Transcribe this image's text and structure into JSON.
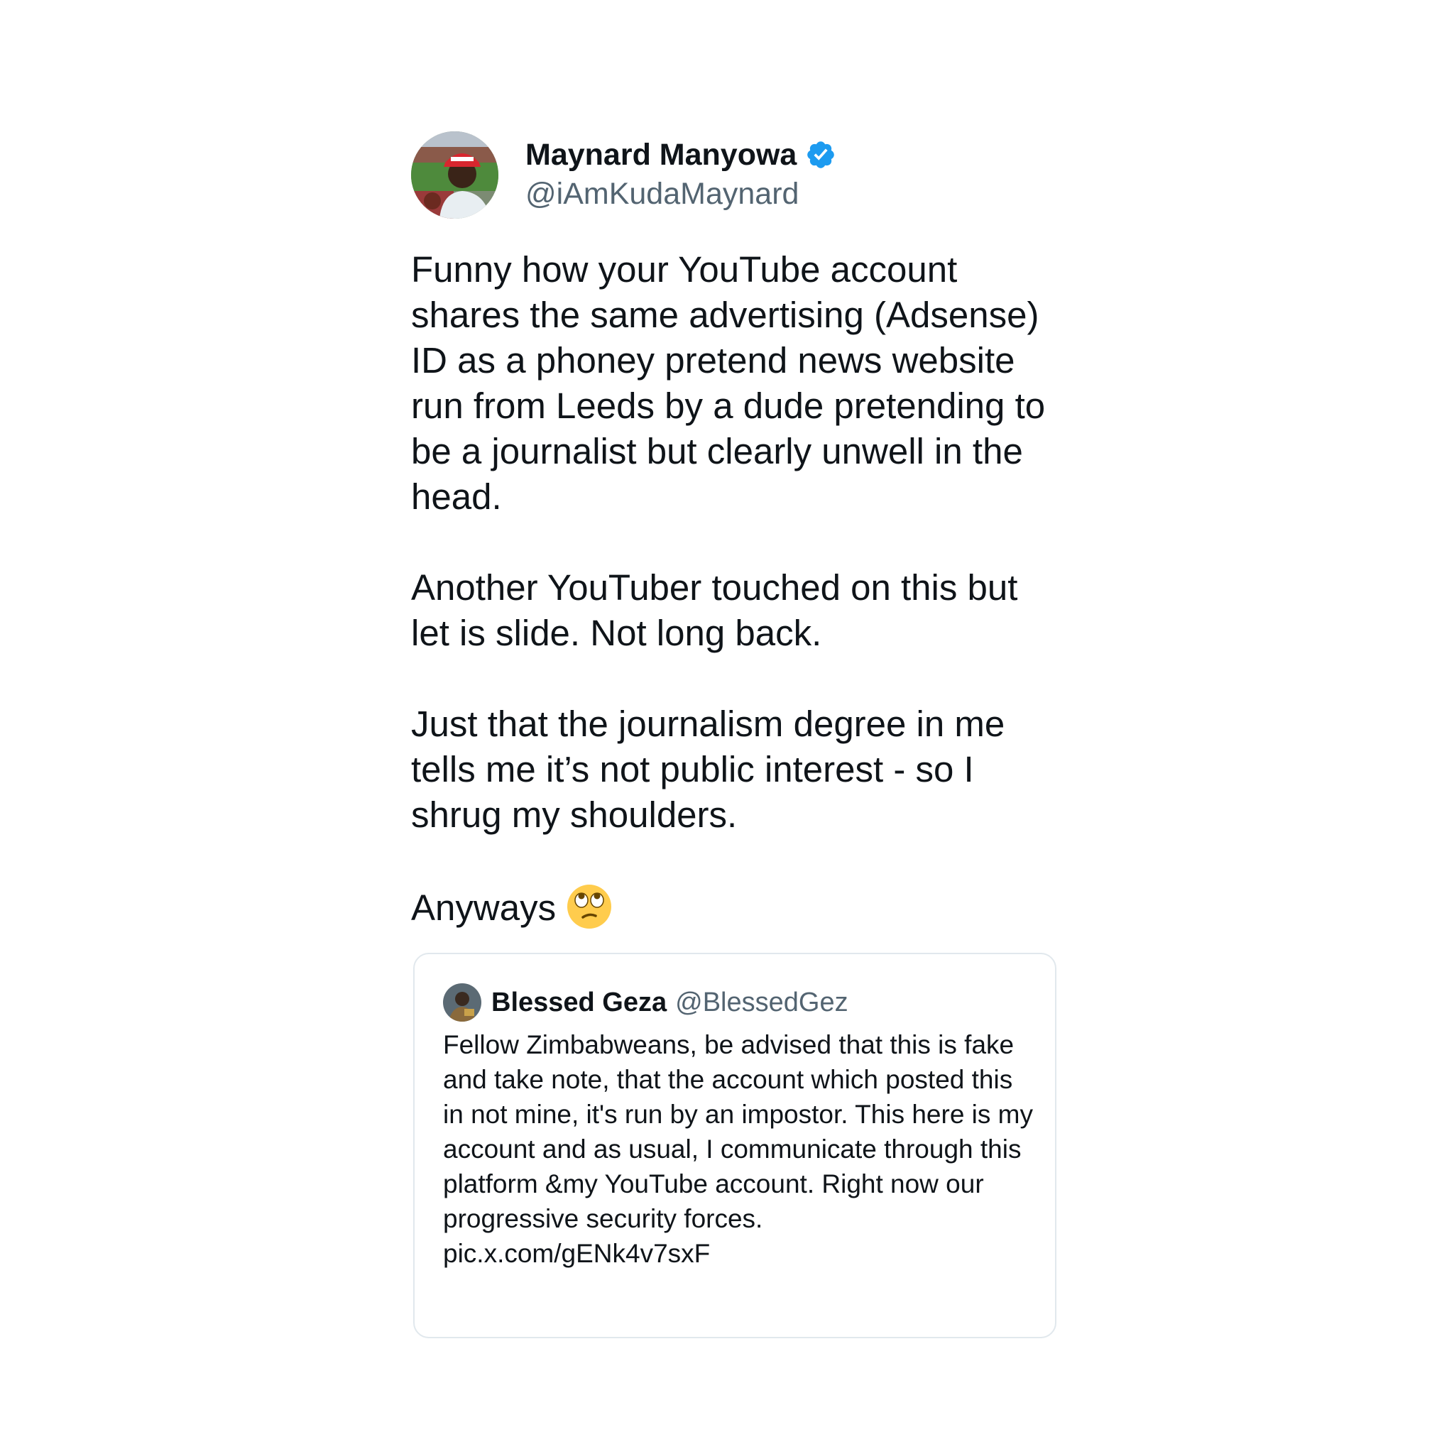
{
  "tweet": {
    "author": {
      "name": "Maynard Manyowa",
      "handle": "@iAmKudaMaynard",
      "verified": true,
      "avatar_icon": "profile-photo-stadium"
    },
    "text": "Funny how your YouTube account shares the same advertising (Adsense) ID as a phoney pretend news website run from Leeds by a dude pretending to be a journalist but clearly unwell in the head.\n\nAnother YouTuber touched on this but let is slide. Not long back.\n\nJust that the journalism degree in me tells me it’s not public interest - so I shrug my shoulders.\n\nAnyways",
    "emoji": "face-with-rolling-eyes",
    "colors": {
      "verified_badge": "#1d9bf0",
      "text": "#0f1419",
      "secondary_text": "#536471",
      "card_border": "#e1e8ed"
    }
  },
  "quoted_tweet": {
    "author": {
      "name": "Blessed Geza",
      "handle": "@BlessedGeza",
      "avatar_icon": "profile-photo"
    },
    "text": "Fellow Zimbabweans,  be advised that this is fake and take note, that the account which posted this in not mine, it's run by an impostor. This here is my account and as usual, I communicate through this platform &my YouTube account. Right now our progressive security forces.\npic.x.com/gENk4v7sxF"
  }
}
